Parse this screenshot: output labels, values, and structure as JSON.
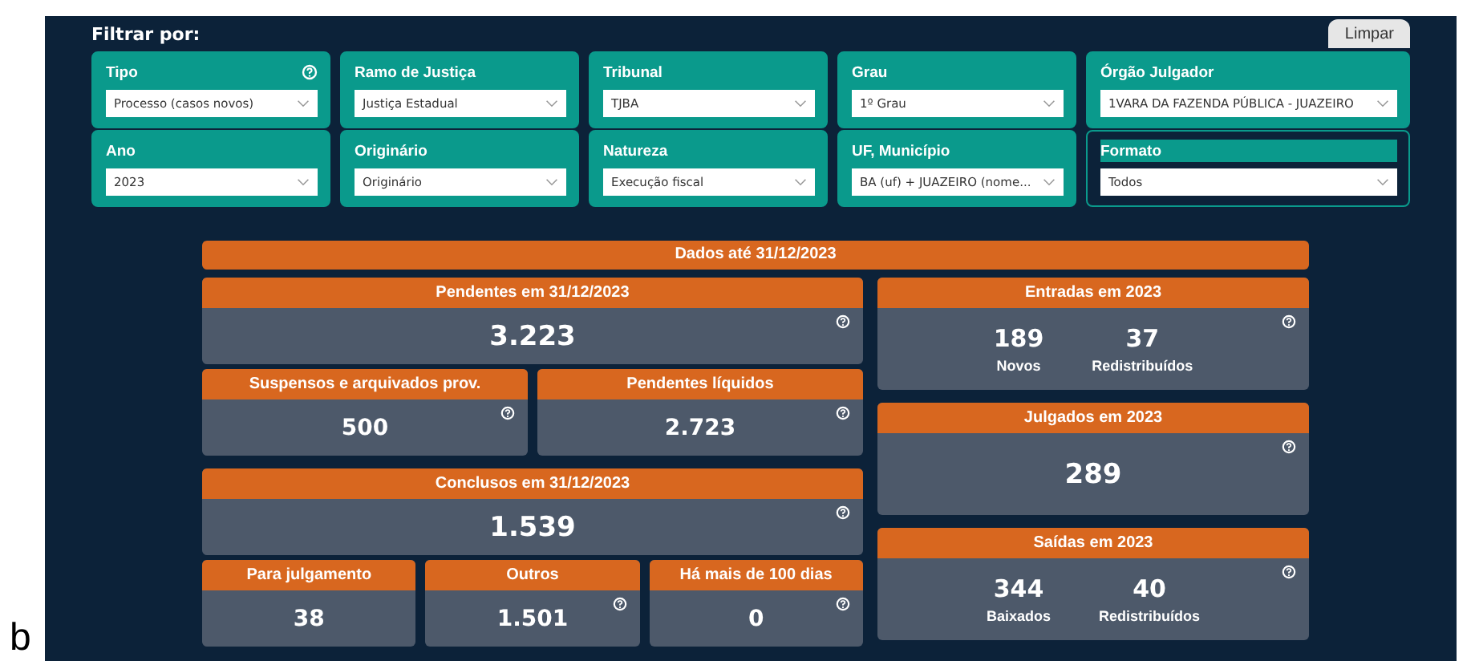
{
  "filter_title": "Filtrar por:",
  "clear_button": "Limpar",
  "filters": [
    {
      "label": "Tipo",
      "value": "Processo (casos novos)",
      "help": true,
      "focused": false
    },
    {
      "label": "Ramo de Justiça",
      "value": "Justiça Estadual",
      "help": false,
      "focused": false
    },
    {
      "label": "Tribunal",
      "value": "TJBA",
      "help": false,
      "focused": false
    },
    {
      "label": "Grau",
      "value": "1º Grau",
      "help": false,
      "focused": false
    },
    {
      "label": "Órgão Julgador",
      "value": "1VARA DA FAZENDA PÚBLICA - JUAZEIRO",
      "help": false,
      "focused": false
    },
    {
      "label": "Ano",
      "value": "2023",
      "help": false,
      "focused": false
    },
    {
      "label": "Originário",
      "value": "Originário",
      "help": false,
      "focused": false
    },
    {
      "label": "Natureza",
      "value": "Execução fiscal",
      "help": false,
      "focused": false
    },
    {
      "label": "UF, Município",
      "value": "BA (uf) + JUAZEIRO (nome...",
      "help": false,
      "focused": false
    },
    {
      "label": "Formato",
      "value": "Todos",
      "help": false,
      "focused": true
    }
  ],
  "header": "Dados até 31/12/2023",
  "left_rows": [
    [
      {
        "title": "Pendentes em 31/12/2023",
        "value": "3.223",
        "help": true,
        "big": true
      }
    ],
    [
      {
        "title": "Suspensos e arquivados prov.",
        "value": "500",
        "help": true,
        "big": false
      },
      {
        "title": "Pendentes líquidos",
        "value": "2.723",
        "help": true,
        "big": false
      }
    ],
    [
      {
        "title": "Conclusos em 31/12/2023",
        "value": "1.539",
        "help": true,
        "big": true
      }
    ],
    [
      {
        "title": "Para julgamento",
        "value": "38",
        "help": false,
        "big": false
      },
      {
        "title": "Outros",
        "value": "1.501",
        "help": true,
        "big": false
      },
      {
        "title": "Há mais de 100 dias",
        "value": "0",
        "help": true,
        "big": false
      }
    ]
  ],
  "right_cards": [
    {
      "title": "Entradas em 2023",
      "help": true,
      "values": [
        {
          "value": "189",
          "caption": "Novos"
        },
        {
          "value": "37",
          "caption": "Redistribuídos"
        }
      ]
    },
    {
      "title": "Julgados em 2023",
      "help": true,
      "values": [
        {
          "value": "289"
        }
      ]
    },
    {
      "title": "Saídas em 2023",
      "help": true,
      "values": [
        {
          "value": "344",
          "caption": "Baixados"
        },
        {
          "value": "40",
          "caption": "Redistribuídos"
        }
      ]
    }
  ],
  "corner_letter": "b"
}
